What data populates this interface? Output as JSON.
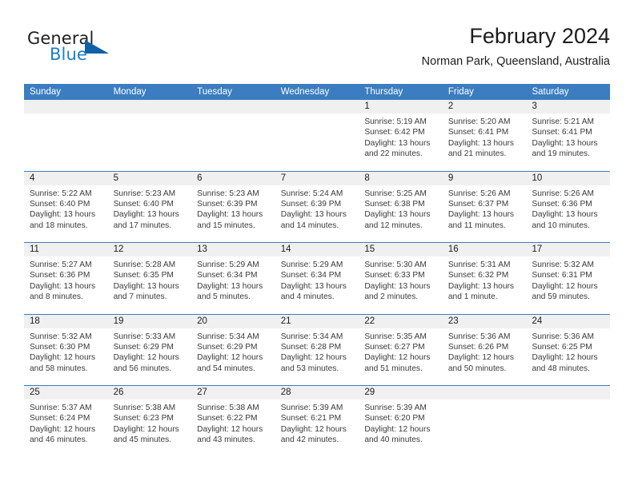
{
  "brand": {
    "name_top": "General",
    "name_bottom": "Blue",
    "mark": "triangle-logo"
  },
  "header": {
    "title": "February 2024",
    "location": "Norman Park, Queensland, Australia"
  },
  "colors": {
    "header_blue": "#3b7dc0",
    "brand_blue": "#1a7fc6",
    "day_band": "#f0f0f0",
    "text": "#1c1c1c"
  },
  "weekdays": [
    "Sunday",
    "Monday",
    "Tuesday",
    "Wednesday",
    "Thursday",
    "Friday",
    "Saturday"
  ],
  "weeks": [
    [
      {
        "day": "",
        "lines": []
      },
      {
        "day": "",
        "lines": []
      },
      {
        "day": "",
        "lines": []
      },
      {
        "day": "",
        "lines": []
      },
      {
        "day": "1",
        "lines": [
          "Sunrise: 5:19 AM",
          "Sunset: 6:42 PM",
          "Daylight: 13 hours",
          "and 22 minutes."
        ]
      },
      {
        "day": "2",
        "lines": [
          "Sunrise: 5:20 AM",
          "Sunset: 6:41 PM",
          "Daylight: 13 hours",
          "and 21 minutes."
        ]
      },
      {
        "day": "3",
        "lines": [
          "Sunrise: 5:21 AM",
          "Sunset: 6:41 PM",
          "Daylight: 13 hours",
          "and 19 minutes."
        ]
      }
    ],
    [
      {
        "day": "4",
        "lines": [
          "Sunrise: 5:22 AM",
          "Sunset: 6:40 PM",
          "Daylight: 13 hours",
          "and 18 minutes."
        ]
      },
      {
        "day": "5",
        "lines": [
          "Sunrise: 5:23 AM",
          "Sunset: 6:40 PM",
          "Daylight: 13 hours",
          "and 17 minutes."
        ]
      },
      {
        "day": "6",
        "lines": [
          "Sunrise: 5:23 AM",
          "Sunset: 6:39 PM",
          "Daylight: 13 hours",
          "and 15 minutes."
        ]
      },
      {
        "day": "7",
        "lines": [
          "Sunrise: 5:24 AM",
          "Sunset: 6:39 PM",
          "Daylight: 13 hours",
          "and 14 minutes."
        ]
      },
      {
        "day": "8",
        "lines": [
          "Sunrise: 5:25 AM",
          "Sunset: 6:38 PM",
          "Daylight: 13 hours",
          "and 12 minutes."
        ]
      },
      {
        "day": "9",
        "lines": [
          "Sunrise: 5:26 AM",
          "Sunset: 6:37 PM",
          "Daylight: 13 hours",
          "and 11 minutes."
        ]
      },
      {
        "day": "10",
        "lines": [
          "Sunrise: 5:26 AM",
          "Sunset: 6:36 PM",
          "Daylight: 13 hours",
          "and 10 minutes."
        ]
      }
    ],
    [
      {
        "day": "11",
        "lines": [
          "Sunrise: 5:27 AM",
          "Sunset: 6:36 PM",
          "Daylight: 13 hours",
          "and 8 minutes."
        ]
      },
      {
        "day": "12",
        "lines": [
          "Sunrise: 5:28 AM",
          "Sunset: 6:35 PM",
          "Daylight: 13 hours",
          "and 7 minutes."
        ]
      },
      {
        "day": "13",
        "lines": [
          "Sunrise: 5:29 AM",
          "Sunset: 6:34 PM",
          "Daylight: 13 hours",
          "and 5 minutes."
        ]
      },
      {
        "day": "14",
        "lines": [
          "Sunrise: 5:29 AM",
          "Sunset: 6:34 PM",
          "Daylight: 13 hours",
          "and 4 minutes."
        ]
      },
      {
        "day": "15",
        "lines": [
          "Sunrise: 5:30 AM",
          "Sunset: 6:33 PM",
          "Daylight: 13 hours",
          "and 2 minutes."
        ]
      },
      {
        "day": "16",
        "lines": [
          "Sunrise: 5:31 AM",
          "Sunset: 6:32 PM",
          "Daylight: 13 hours",
          "and 1 minute."
        ]
      },
      {
        "day": "17",
        "lines": [
          "Sunrise: 5:32 AM",
          "Sunset: 6:31 PM",
          "Daylight: 12 hours",
          "and 59 minutes."
        ]
      }
    ],
    [
      {
        "day": "18",
        "lines": [
          "Sunrise: 5:32 AM",
          "Sunset: 6:30 PM",
          "Daylight: 12 hours",
          "and 58 minutes."
        ]
      },
      {
        "day": "19",
        "lines": [
          "Sunrise: 5:33 AM",
          "Sunset: 6:29 PM",
          "Daylight: 12 hours",
          "and 56 minutes."
        ]
      },
      {
        "day": "20",
        "lines": [
          "Sunrise: 5:34 AM",
          "Sunset: 6:29 PM",
          "Daylight: 12 hours",
          "and 54 minutes."
        ]
      },
      {
        "day": "21",
        "lines": [
          "Sunrise: 5:34 AM",
          "Sunset: 6:28 PM",
          "Daylight: 12 hours",
          "and 53 minutes."
        ]
      },
      {
        "day": "22",
        "lines": [
          "Sunrise: 5:35 AM",
          "Sunset: 6:27 PM",
          "Daylight: 12 hours",
          "and 51 minutes."
        ]
      },
      {
        "day": "23",
        "lines": [
          "Sunrise: 5:36 AM",
          "Sunset: 6:26 PM",
          "Daylight: 12 hours",
          "and 50 minutes."
        ]
      },
      {
        "day": "24",
        "lines": [
          "Sunrise: 5:36 AM",
          "Sunset: 6:25 PM",
          "Daylight: 12 hours",
          "and 48 minutes."
        ]
      }
    ],
    [
      {
        "day": "25",
        "lines": [
          "Sunrise: 5:37 AM",
          "Sunset: 6:24 PM",
          "Daylight: 12 hours",
          "and 46 minutes."
        ]
      },
      {
        "day": "26",
        "lines": [
          "Sunrise: 5:38 AM",
          "Sunset: 6:23 PM",
          "Daylight: 12 hours",
          "and 45 minutes."
        ]
      },
      {
        "day": "27",
        "lines": [
          "Sunrise: 5:38 AM",
          "Sunset: 6:22 PM",
          "Daylight: 12 hours",
          "and 43 minutes."
        ]
      },
      {
        "day": "28",
        "lines": [
          "Sunrise: 5:39 AM",
          "Sunset: 6:21 PM",
          "Daylight: 12 hours",
          "and 42 minutes."
        ]
      },
      {
        "day": "29",
        "lines": [
          "Sunrise: 5:39 AM",
          "Sunset: 6:20 PM",
          "Daylight: 12 hours",
          "and 40 minutes."
        ]
      },
      {
        "day": "",
        "lines": []
      },
      {
        "day": "",
        "lines": []
      }
    ]
  ]
}
